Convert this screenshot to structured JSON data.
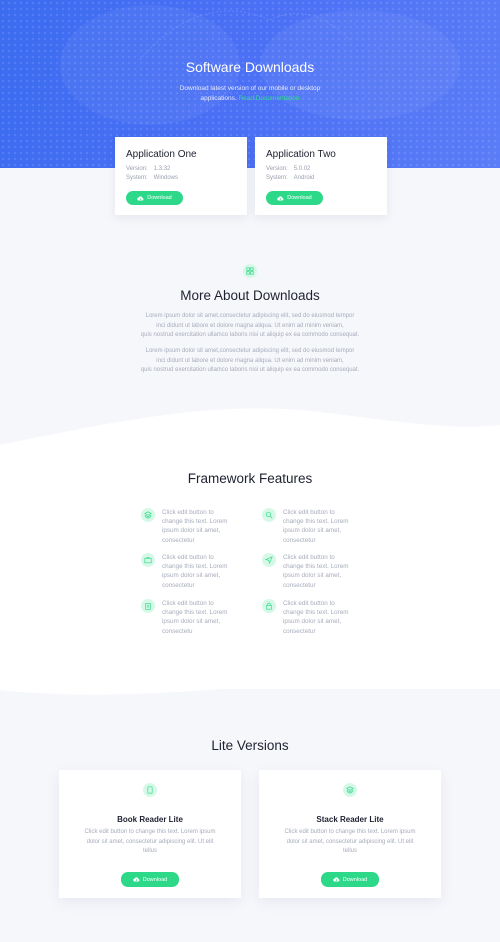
{
  "hero": {
    "title": "Software Downloads",
    "subtitle_line1": "Download latest version of our mobile or desktop",
    "subtitle_line2": "applications.",
    "read_link": "Read Documentation"
  },
  "apps": [
    {
      "name": "Application One",
      "version_label": "Version:",
      "version": "1.3.32",
      "system_label": "System:",
      "system": "Windows",
      "button": "Download"
    },
    {
      "name": "Application Two",
      "version_label": "Version:",
      "version": "5.0.02",
      "system_label": "System:",
      "system": "Android",
      "button": "Download"
    }
  ],
  "about": {
    "title": "More About Downloads",
    "para1": [
      "Lorem ipsum dolor sit amet,consectetur adipiscing elit, sed do eiusmod tempor",
      "inci didunt ut labore et dolore magna aliqua. Ut enim ad minim veniam,",
      "quis nostrud exercitation ullamco laboris nisi ut aliquip ex ea commodo consequat."
    ],
    "para2": [
      "Lorem ipsum dolor sit amet,consectetur adipiscing elit, sed do eiusmod tempor",
      "inci didunt ut labore et dolore magna aliqua. Ut enim ad minim veniam,",
      "quis nostrud exercitation ullamco laboris nisi ut aliquip ex ea commodo consequat."
    ]
  },
  "features": {
    "title": "Framework Features",
    "items": [
      {
        "icon": "layers-icon",
        "lines": [
          "Click edit button to",
          "change this text. Lorem",
          "ipsum dolor sit amet,",
          "consectetur"
        ]
      },
      {
        "icon": "search-icon",
        "lines": [
          "Click edit button to",
          "change this text. Lorem",
          "ipsum dolor sit amet,",
          "consectetur"
        ]
      },
      {
        "icon": "briefcase-icon",
        "lines": [
          "Click edit button to",
          "change this text. Lorem",
          "ipsum dolor sit amet,",
          "consectetur"
        ]
      },
      {
        "icon": "navigation-icon",
        "lines": [
          "Click edit button to",
          "change this text. Lorem",
          "ipsum dolor sit amet,",
          "consectetur"
        ]
      },
      {
        "icon": "clipboard-icon",
        "lines": [
          "Click edit button to",
          "change this text. Lorem",
          "ipsum dolor sit amet,",
          "consectetu"
        ]
      },
      {
        "icon": "lock-icon",
        "lines": [
          "Click edit button to",
          "change this text. Lorem",
          "ipsum dolor sit amet,",
          "consectetur"
        ]
      }
    ]
  },
  "lite": {
    "title": "Lite Versions",
    "cards": [
      {
        "icon": "tablet-icon",
        "name": "Book Reader Lite",
        "lines": [
          "Click edit button to change this text. Lorem ipsum",
          "dolor sit amet, consectetur adipiscing elit. Ut elit",
          "tellus"
        ],
        "button": "Download"
      },
      {
        "icon": "layers-icon",
        "name": "Stack Reader Lite",
        "lines": [
          "Click edit button to change this text. Lorem ipsum",
          "dolor sit amet, consectetur adipiscing elit. Ut elit",
          "tellus"
        ],
        "button": "Download"
      }
    ]
  },
  "colors": {
    "hero_start": "#3b6cf0",
    "hero_end": "#5a7cf7",
    "accent_green": "#2ed889",
    "icon_bg": "#d6f8e7",
    "text_muted": "#a7acbb"
  }
}
